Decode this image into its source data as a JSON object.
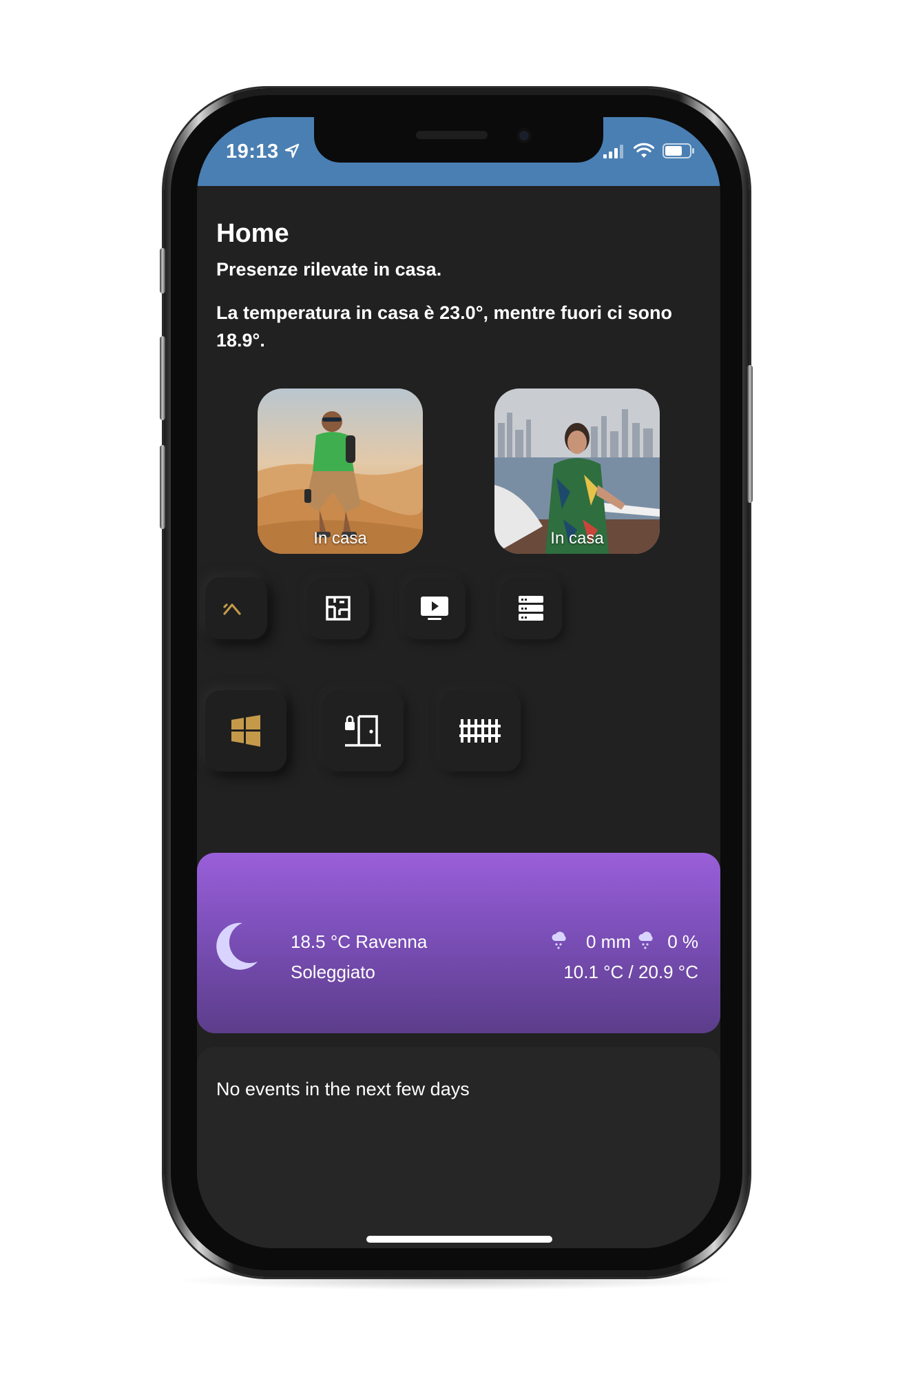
{
  "status_bar": {
    "time": "19:13",
    "location_icon": "location-arrow-icon",
    "signal_icon": "cellular-signal-icon",
    "wifi_icon": "wifi-icon",
    "battery_icon": "battery-icon",
    "color": "#4a7fb3"
  },
  "header": {
    "title": "Home",
    "presence_text": "Presenze rilevate in casa.",
    "temperature_text": "La temperatura in casa è 23.0°, mentre fuori ci sono 18.9°."
  },
  "people": [
    {
      "status": "In casa"
    },
    {
      "status": "In casa"
    }
  ],
  "nav_tiles": [
    {
      "icon": "home-roof-icon",
      "active": true
    },
    {
      "icon": "floor-plan-icon",
      "active": false
    },
    {
      "icon": "television-play-icon",
      "active": false
    },
    {
      "icon": "server-icon",
      "active": false
    }
  ],
  "control_tiles": [
    {
      "icon": "windows-icon",
      "active": true
    },
    {
      "icon": "door-lock-icon",
      "active": false
    },
    {
      "icon": "fence-gate-icon",
      "active": false
    }
  ],
  "weather": {
    "icon": "moon-icon",
    "temp_location": "18.5 °C Ravenna",
    "condition": "Soleggiato",
    "precipitation": "0 mm",
    "precipitation_probability": "0 %",
    "precip_icon": "cloud-rain-icon",
    "min_max": "10.1 °C / 20.9 °C",
    "gradient_top": "#9a5fd9",
    "gradient_bottom": "#5c3d8a"
  },
  "calendar": {
    "empty_text": "No events in the next few days"
  },
  "accent_color": "#c49a4a"
}
